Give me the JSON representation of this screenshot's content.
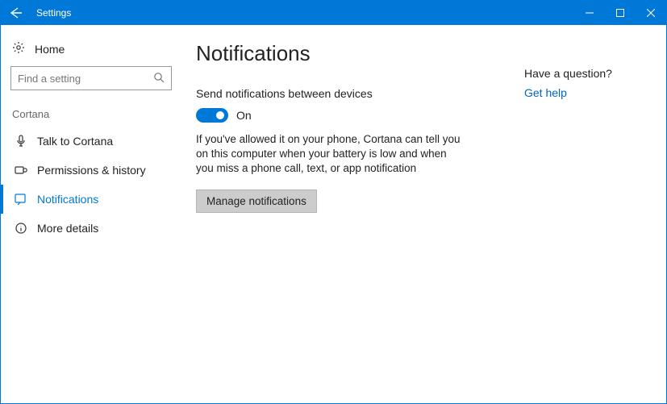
{
  "titlebar": {
    "title": "Settings"
  },
  "sidebar": {
    "home_label": "Home",
    "search_placeholder": "Find a setting",
    "group_label": "Cortana",
    "items": [
      {
        "label": "Talk to Cortana"
      },
      {
        "label": "Permissions & history"
      },
      {
        "label": "Notifications"
      },
      {
        "label": "More details"
      }
    ]
  },
  "main": {
    "heading": "Notifications",
    "setting_label": "Send notifications between devices",
    "toggle_state": "On",
    "description": "If you've allowed it on your phone, Cortana can tell you on this computer when your battery is low and when you miss a phone call, text, or app notification",
    "button_label": "Manage notifications"
  },
  "help": {
    "question": "Have a question?",
    "link": "Get help"
  }
}
